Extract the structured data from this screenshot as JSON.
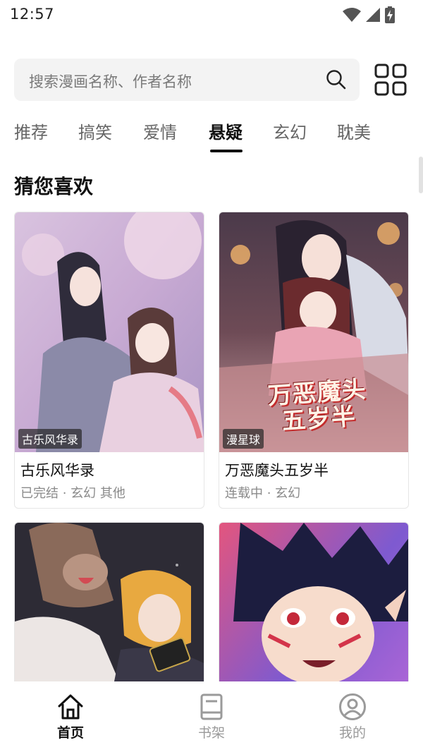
{
  "status_bar": {
    "time": "12:57"
  },
  "search": {
    "placeholder": "搜索漫画名称、作者名称"
  },
  "tabs": [
    {
      "label": "推荐"
    },
    {
      "label": "搞笑"
    },
    {
      "label": "爱情"
    },
    {
      "label": "悬疑",
      "active": true
    },
    {
      "label": "玄幻"
    },
    {
      "label": "耽美"
    }
  ],
  "section": {
    "title": "猜您喜欢"
  },
  "comics": [
    {
      "cover_tag": "古乐风华录",
      "title": "古乐风华录",
      "meta": "已完结 · 玄幻 其他"
    },
    {
      "cover_tag": "漫星球",
      "title": "万恶魔头五岁半",
      "meta": "连载中 · 玄幻",
      "cover_text": "万恶魔头五岁半"
    },
    {
      "cover_tag": "",
      "title": "",
      "meta": ""
    },
    {
      "cover_tag": "",
      "title": "",
      "meta": ""
    }
  ],
  "bottom_nav": [
    {
      "label": "首页",
      "icon": "home-icon",
      "active": true
    },
    {
      "label": "书架",
      "icon": "bookshelf-icon",
      "active": false
    },
    {
      "label": "我的",
      "icon": "profile-icon",
      "active": false
    }
  ],
  "colors": {
    "accent": "#111111",
    "inactive": "#9a9a9a",
    "search_bg": "#f3f3f3"
  }
}
